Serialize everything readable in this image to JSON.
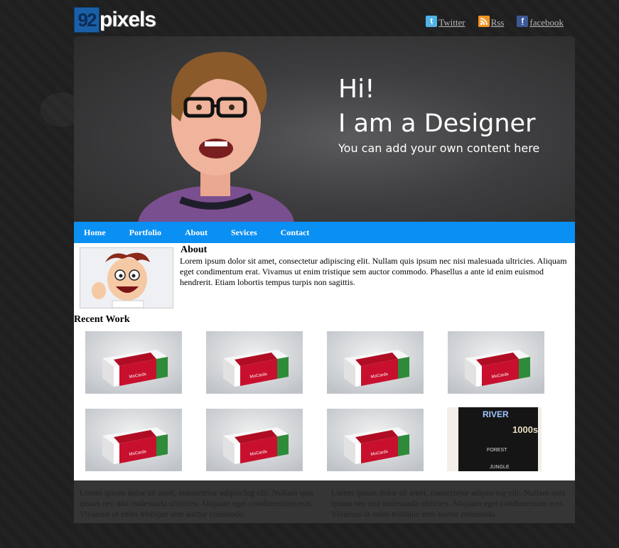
{
  "logo": {
    "mark": "92",
    "text": "pixels"
  },
  "social": [
    {
      "label": "Twitter",
      "icon": "twitter-icon"
    },
    {
      "label": "Rss",
      "icon": "rss-icon"
    },
    {
      "label": "facebook",
      "icon": "facebook-icon"
    }
  ],
  "hero": {
    "greeting": "Hi!",
    "headline": "I am a Designer",
    "subline": "You can add your own content here"
  },
  "nav": {
    "items": [
      "Home",
      "Portfolio",
      "About",
      "Sevices",
      "Contact"
    ]
  },
  "about": {
    "title": "About",
    "text": "Lorem ipsum dolor sit amet, consectetur adipiscing elit. Nullam quis ipsum nec nisi malesuada ultricies. Aliquam eget condimentum erat. Vivamus ut enim tristique sem auctor commodo. Phasellus a ante id enim euismod hendrerit. Etiam lobortis tempus turpis non sagittis."
  },
  "recent_work": {
    "title": "Recent Work",
    "product_brand": "MoCards",
    "poster": {
      "top": "RIVER",
      "mid": "1000s",
      "forest": "FOREST",
      "jungle": "JUNGLE"
    }
  },
  "footer": {
    "col1": "Lorem ipsum dolor sit amet, consectetur adipiscing elit. Nullam quis ipsum nec nisi malesuada ultricies. Aliquam eget condimentum erat. Vivamus ut enim tristique sem auctor commodo.",
    "col2": "Lorem ipsum dolor sit amet, consectetur adipiscing elit. Nullam quis ipsum nec nisi malesuada ultricies. Aliquam eget condimentum erat. Vivamus ut enim tristique sem auctor commodo."
  },
  "colors": {
    "nav": "#0a8ff2",
    "box_red": "#c8102e",
    "box_green": "#2e8b3a"
  }
}
